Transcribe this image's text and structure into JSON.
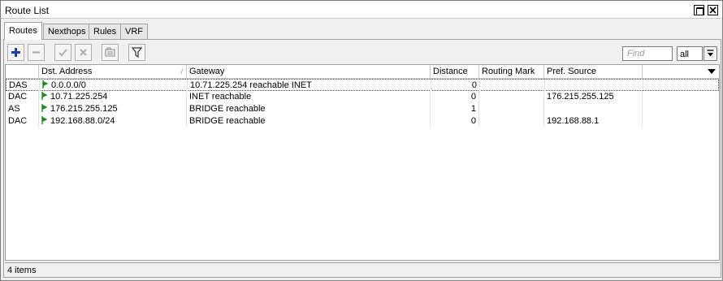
{
  "window": {
    "title": "Route List"
  },
  "tabs": [
    {
      "label": "Routes",
      "active": true
    },
    {
      "label": "Nexthops",
      "active": false
    },
    {
      "label": "Rules",
      "active": false
    },
    {
      "label": "VRF",
      "active": false
    }
  ],
  "toolbar": {
    "buttons": [
      "add-icon",
      "remove-icon",
      "enable-icon",
      "disable-icon",
      "comment-icon",
      "filter-icon"
    ]
  },
  "search": {
    "placeholder": "Find",
    "scope": "all"
  },
  "table": {
    "columns": [
      "",
      "Dst. Address",
      "Gateway",
      "Distance",
      "Routing Mark",
      "Pref. Source"
    ],
    "sort_marker": "/",
    "rows": [
      {
        "flags": "DAS",
        "dst": "0.0.0.0/0",
        "gateway": "10.71.225.254 reachable INET",
        "distance": "0",
        "routing_mark": "",
        "pref_source": ""
      },
      {
        "flags": "DAC",
        "dst": "10.71.225.254",
        "gateway": "INET reachable",
        "distance": "0",
        "routing_mark": "",
        "pref_source": "176.215.255.125"
      },
      {
        "flags": "AS",
        "dst": "176.215.255.125",
        "gateway": "BRIDGE reachable",
        "distance": "1",
        "routing_mark": "",
        "pref_source": ""
      },
      {
        "flags": "DAC",
        "dst": "192.168.88.0/24",
        "gateway": "BRIDGE reachable",
        "distance": "0",
        "routing_mark": "",
        "pref_source": "192.168.88.1"
      }
    ]
  },
  "status": {
    "items": "4 items"
  },
  "colors": {
    "flag": "#1f8a1f",
    "add": "#1a3fb5",
    "accent": "#000000"
  }
}
